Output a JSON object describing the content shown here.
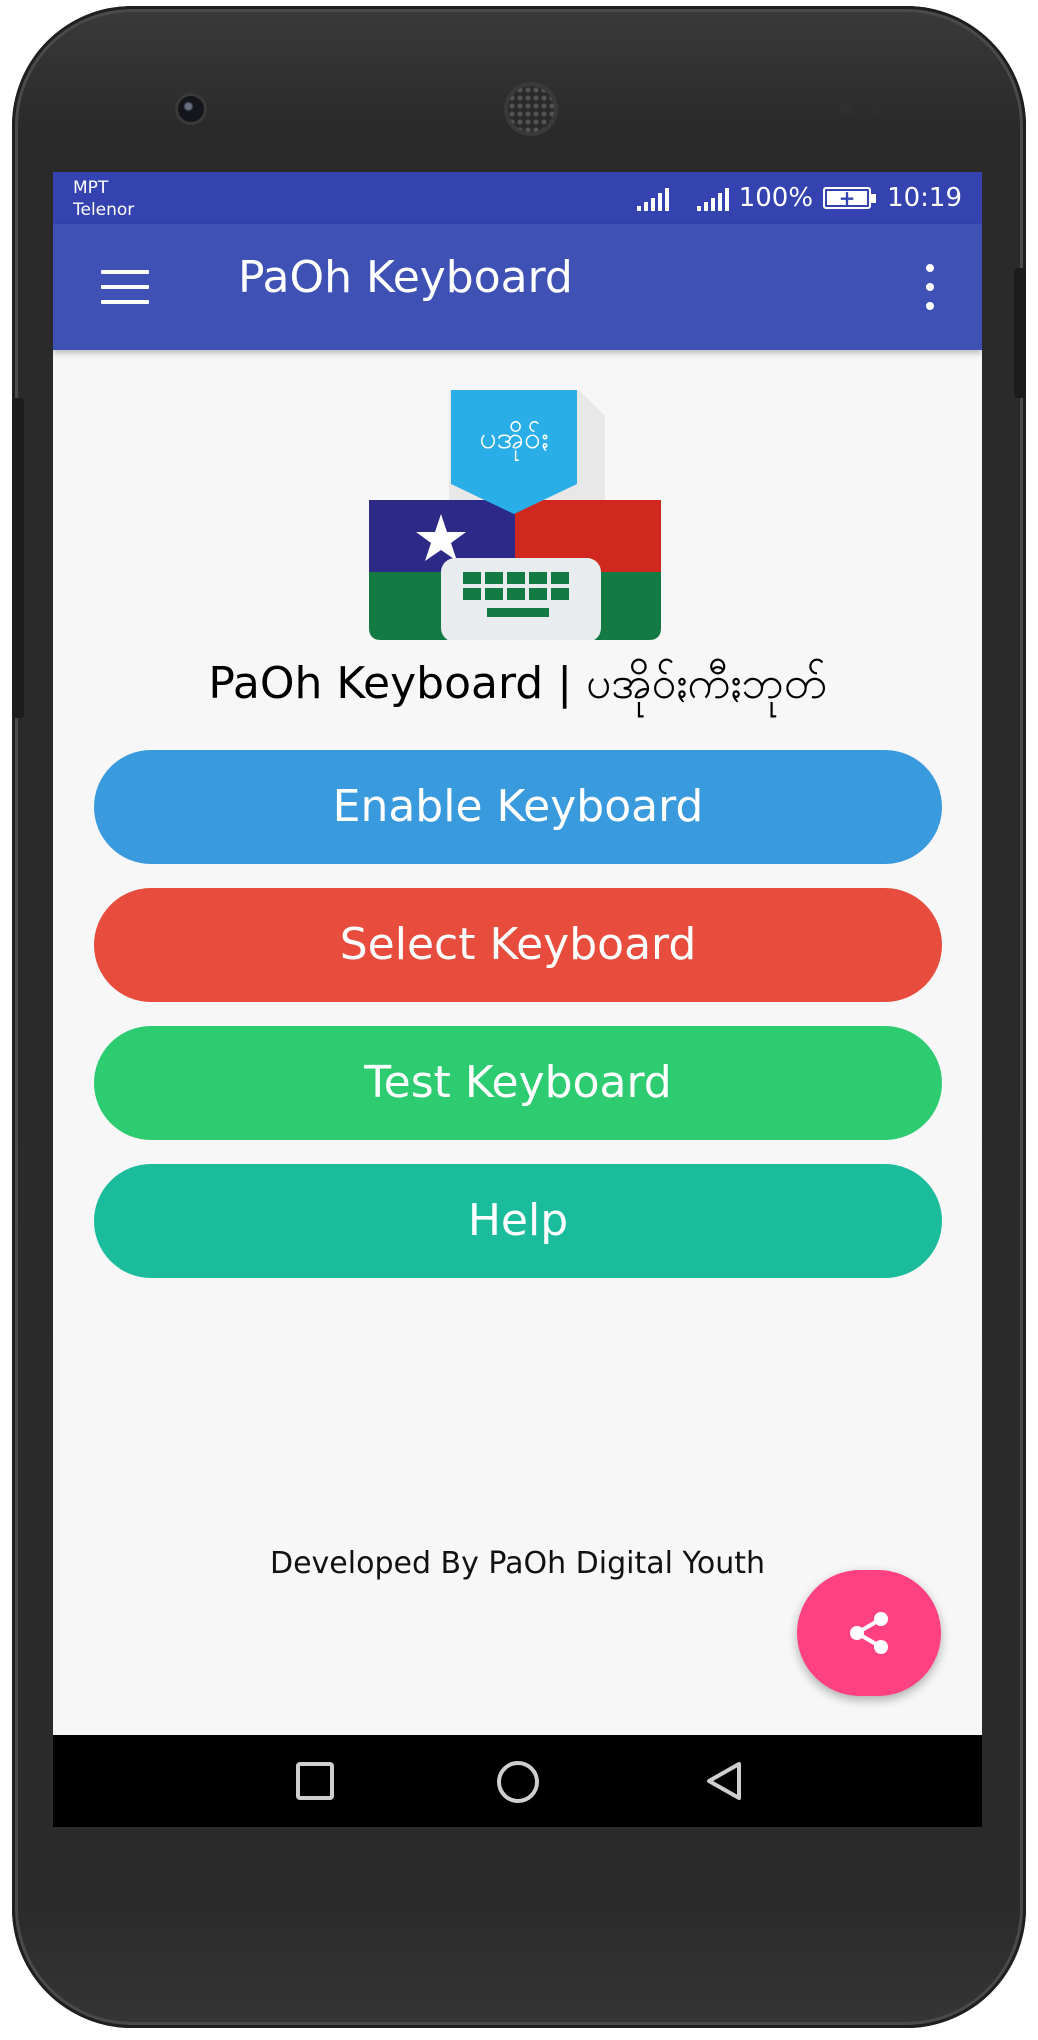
{
  "status_bar": {
    "carrier_1": "MPT",
    "carrier_2": "Telenor",
    "battery_percent": "100%",
    "time": "10:19"
  },
  "app_bar": {
    "title": "PaOh Keyboard",
    "menu_icon": "hamburger-menu-icon",
    "overflow_icon": "more-vert-icon"
  },
  "logo": {
    "label": "ပအိုဝ်ႏ",
    "icon": "keyboard-flag-logo"
  },
  "subtitle": "PaOh Keyboard | ပအိုဝ်ႏကီႏဘုတ်",
  "buttons": {
    "enable": "Enable Keyboard",
    "select": "Select Keyboard",
    "test": "Test Keyboard",
    "help": "Help"
  },
  "footer": "Developed By PaOh Digital Youth",
  "fab": {
    "icon": "share-icon"
  },
  "nav_bar": {
    "recents_icon": "square-recents-icon",
    "home_icon": "circle-home-icon",
    "back_icon": "triangle-back-icon"
  },
  "colors": {
    "status_bar": "#3443b0",
    "app_bar": "#3f51b5",
    "enable": "#3a9ade",
    "select": "#e74c3c",
    "test": "#2ecc71",
    "help": "#1abc9c",
    "fab": "#ff4081",
    "background": "#f7f7f7"
  }
}
